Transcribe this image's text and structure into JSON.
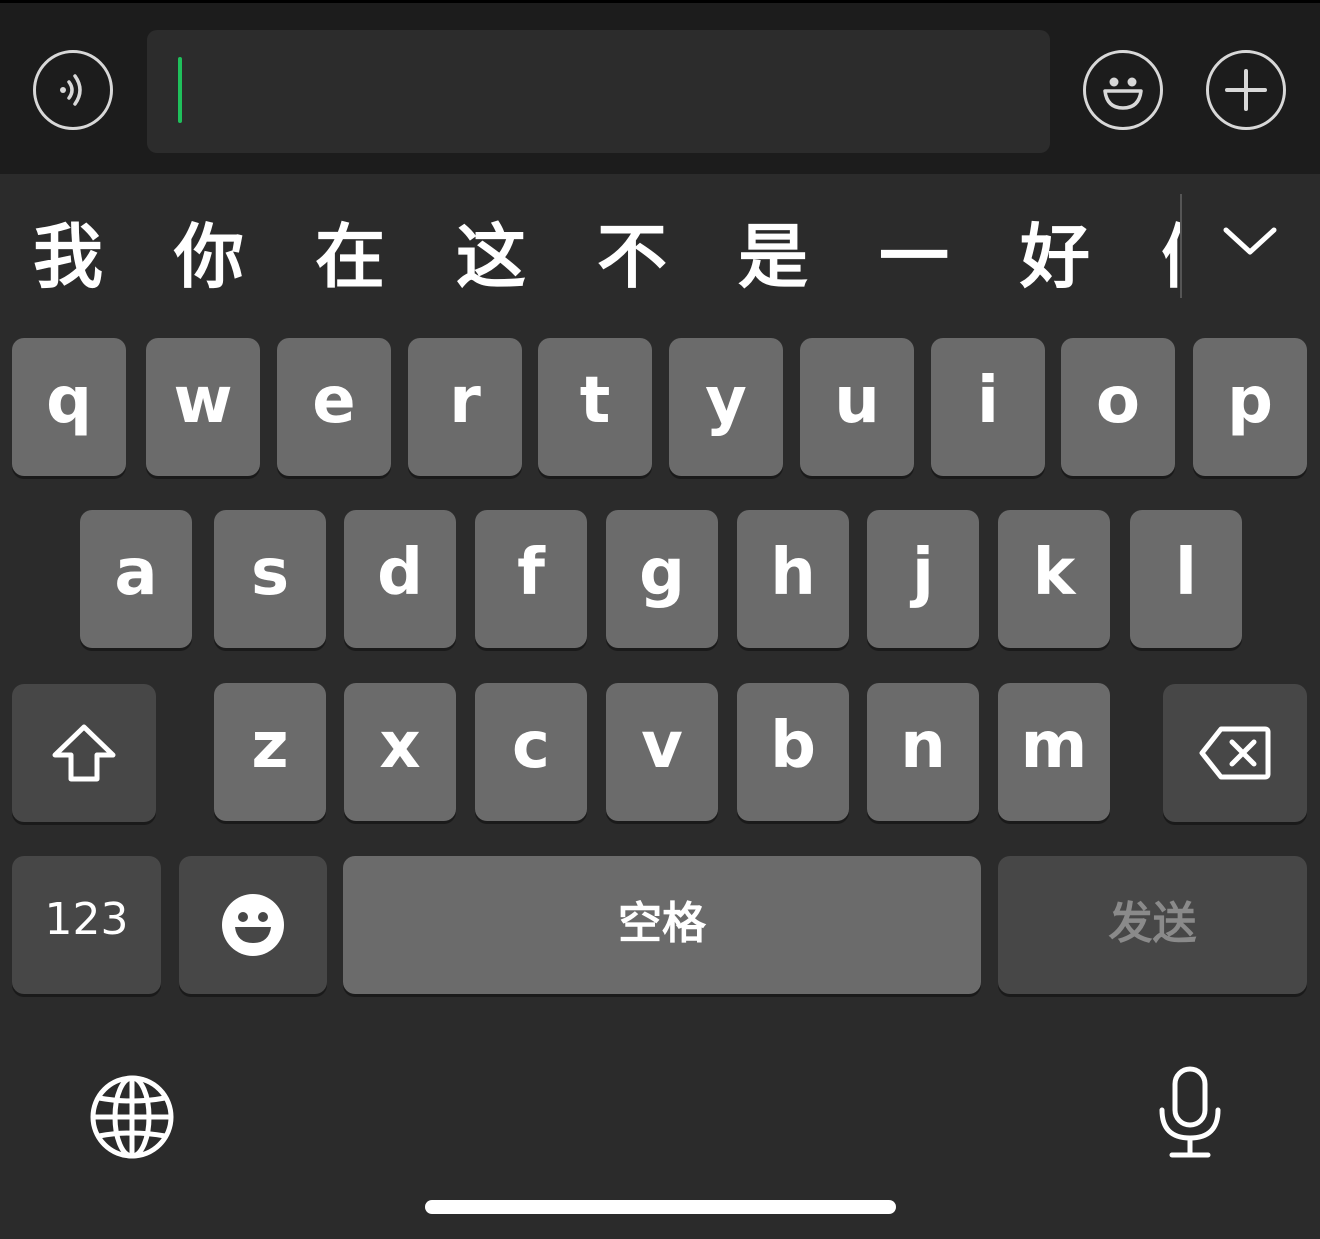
{
  "input_bar": {
    "voice_icon": "voice-wave-icon",
    "emoji_icon": "smiley-icon",
    "plus_icon": "plus-icon",
    "text_value": "",
    "accent_color": "#1fc05b"
  },
  "candidates": [
    "我",
    "你",
    "在",
    "这",
    "不",
    "是",
    "一",
    "好",
    "们"
  ],
  "keyboard": {
    "row1": [
      "q",
      "w",
      "e",
      "r",
      "t",
      "y",
      "u",
      "i",
      "o",
      "p"
    ],
    "row2": [
      "a",
      "s",
      "d",
      "f",
      "g",
      "h",
      "j",
      "k",
      "l"
    ],
    "row3": [
      "z",
      "x",
      "c",
      "v",
      "b",
      "n",
      "m"
    ],
    "numbers_label": "123",
    "space_label": "空格",
    "send_label": "发送",
    "shift_icon": "shift-arrow-icon",
    "delete_icon": "backspace-icon",
    "emoji_key_icon": "emoji-icon",
    "globe_icon": "globe-icon",
    "mic_icon": "microphone-icon",
    "expand_icon": "chevron-down-icon"
  }
}
